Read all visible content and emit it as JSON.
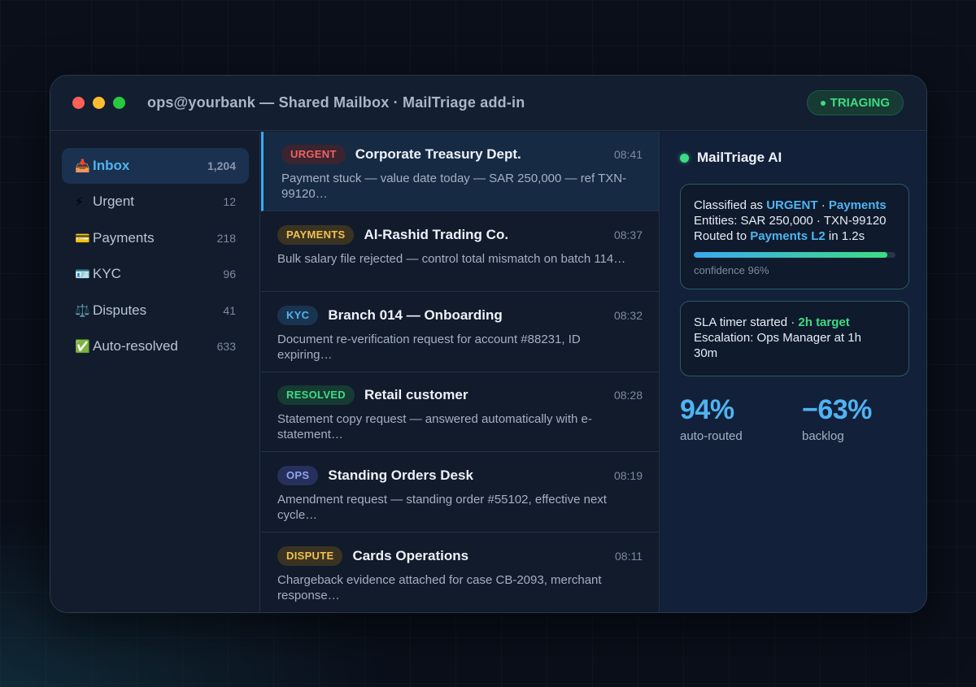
{
  "window": {
    "title": "ops@yourbank — Shared Mailbox · MailTriage add-in",
    "status": "TRIAGING"
  },
  "sidebar": {
    "items": [
      {
        "icon": "📥",
        "icon_name": "inbox-tray-icon",
        "label": "Inbox",
        "count": "1,204",
        "active": true
      },
      {
        "icon": "⚡",
        "icon_name": "lightning-icon",
        "label": "Urgent",
        "count": "12"
      },
      {
        "icon": "💳",
        "icon_name": "credit-card-icon",
        "label": "Payments",
        "count": "218"
      },
      {
        "icon": "🪪",
        "icon_name": "id-card-icon",
        "label": "KYC",
        "count": "96"
      },
      {
        "icon": "⚖️",
        "icon_name": "scales-icon",
        "label": "Disputes",
        "count": "41"
      },
      {
        "icon": "✅",
        "icon_name": "check-box-icon",
        "label": "Auto-resolved",
        "count": "633"
      }
    ]
  },
  "messages": [
    {
      "tag": "URGENT",
      "tag_color": "#f06262",
      "tag_bg": "#3a2430",
      "sender": "Corporate Treasury Dept.",
      "time": "08:41",
      "snippet": "Payment stuck — value date today — SAR 250,000 — ref TXN-99120…",
      "selected": true
    },
    {
      "tag": "PAYMENTS",
      "tag_color": "#f2c14e",
      "tag_bg": "#3a3322",
      "sender": "Al-Rashid Trading Co.",
      "time": "08:37",
      "snippet": "Bulk salary file rejected — control total mismatch on batch 114…"
    },
    {
      "tag": "KYC",
      "tag_color": "#4fb4f0",
      "tag_bg": "#1a3350",
      "sender": "Branch 014 — Onboarding",
      "time": "08:32",
      "snippet": "Document re-verification request for account #88231, ID expiring…"
    },
    {
      "tag": "RESOLVED",
      "tag_color": "#3ddc84",
      "tag_bg": "#173a33",
      "sender": "Retail customer",
      "time": "08:28",
      "snippet": "Statement copy request — answered automatically with e-statement…"
    },
    {
      "tag": "OPS",
      "tag_color": "#8ea2f0",
      "tag_bg": "#26305a",
      "sender": "Standing Orders Desk",
      "time": "08:19",
      "snippet": "Amendment request — standing order #55102, effective next cycle…"
    },
    {
      "tag": "DISPUTE",
      "tag_color": "#f2c14e",
      "tag_bg": "#3a3322",
      "sender": "Cards Operations",
      "time": "08:11",
      "snippet": "Chargeback evidence attached for case CB-2093, merchant response…"
    }
  ],
  "ai_panel": {
    "title": "MailTriage AI",
    "classification": {
      "prefix": "Classified as ",
      "category": "URGENT",
      "sep": " · ",
      "queue": "Payments",
      "entities": "Entities: SAR 250,000 · TXN-99120",
      "routed_prefix": "Routed to ",
      "routed_target": "Payments L2",
      "routed_suffix": " in 1.2s",
      "confidence_label": "confidence 96%",
      "confidence": 0.96
    },
    "sla": {
      "prefix": "SLA timer started · ",
      "target": "2h target",
      "escalation_line1": "Escalation: Ops Manager at 1h",
      "escalation_line2": "30m"
    },
    "stats": [
      {
        "value": "94%",
        "label": "auto-routed"
      },
      {
        "value": "−63%",
        "label": "backlog"
      }
    ]
  }
}
